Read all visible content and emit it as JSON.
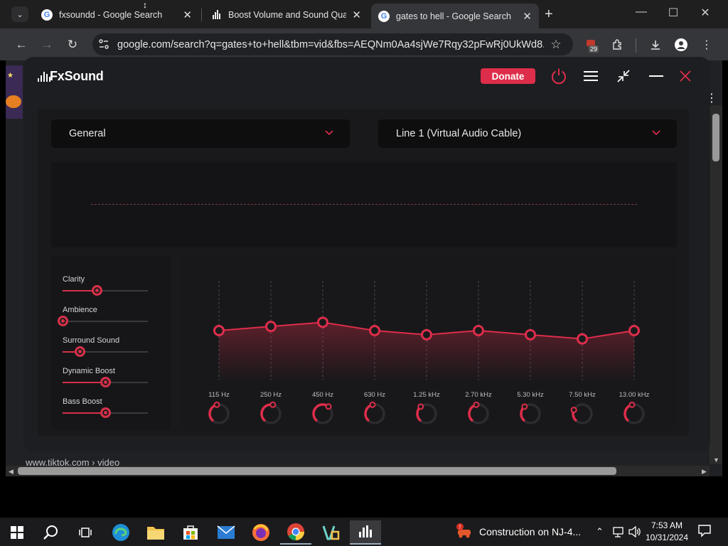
{
  "browser": {
    "tabs": [
      {
        "title": "fxsoundd - Google Search",
        "icon": "google-icon",
        "active": false
      },
      {
        "title": "Boost Volume and Sound Quali",
        "icon": "fxsound-icon",
        "active": false
      },
      {
        "title": "gates to hell - Google Search",
        "icon": "google-icon",
        "active": true
      }
    ],
    "url": "google.com/search?q=gates+to+hell&tbm=vid&fbs=AEQNm0Aa4sjWe7Rqy32pFwRj0UkWd8...",
    "extension_badge": "29"
  },
  "webpage": {
    "result_url": "www.tiktok.com › video"
  },
  "fxsound": {
    "app_name": "FxSound",
    "donate_label": "Donate",
    "preset": "General",
    "output_device": "Line 1 (Virtual Audio Cable)",
    "accent_color": "#de2d4a",
    "effects": [
      {
        "name": "Clarity",
        "level": 0.4
      },
      {
        "name": "Ambience",
        "level": 0.0
      },
      {
        "name": "Surround Sound",
        "level": 0.2
      },
      {
        "name": "Dynamic Boost",
        "level": 0.5
      },
      {
        "name": "Bass Boost",
        "level": 0.5
      }
    ],
    "eq_bands": [
      {
        "label": "115 Hz",
        "gain": 0.0
      },
      {
        "label": "250 Hz",
        "gain": 0.8
      },
      {
        "label": "450 Hz",
        "gain": 1.6
      },
      {
        "label": "630 Hz",
        "gain": 0.0
      },
      {
        "label": "1.25 kHz",
        "gain": -0.8
      },
      {
        "label": "2.70 kHz",
        "gain": 0.0
      },
      {
        "label": "5.30 kHz",
        "gain": -0.8
      },
      {
        "label": "7.50 kHz",
        "gain": -1.6
      },
      {
        "label": "13.00 kHz",
        "gain": 0.0
      }
    ]
  },
  "taskbar": {
    "news": "Construction on NJ-4...",
    "time": "7:53 AM",
    "date": "10/31/2024"
  }
}
